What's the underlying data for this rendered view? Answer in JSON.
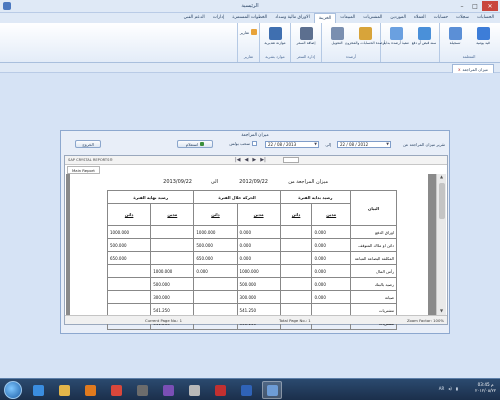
{
  "window": {
    "title": "الرئيسية",
    "controls": {
      "minimize": "–",
      "maximize": "□",
      "close": "✕"
    }
  },
  "ribbon_tabs": [
    {
      "label": "الحسابات",
      "active": false
    },
    {
      "label": "سجلات",
      "active": false
    },
    {
      "label": "حسابات",
      "active": false
    },
    {
      "label": "العملاء",
      "active": false
    },
    {
      "label": "الموردين",
      "active": false
    },
    {
      "label": "المشتريات",
      "active": false
    },
    {
      "label": "المبيعات",
      "active": false
    },
    {
      "label": "الخزينة",
      "active": true
    },
    {
      "label": "الاوراق مالية وسداد",
      "active": false
    },
    {
      "label": "الخطوات المستمرة",
      "active": false
    },
    {
      "label": "إدارات",
      "active": false
    },
    {
      "label": "الدعم الفني",
      "active": false
    }
  ],
  "ribbon_groups": [
    {
      "label": "المتعلمة",
      "buttons": [
        {
          "label": "قيد يومية",
          "icon": "journal-icon",
          "color": "#3d7dd8"
        },
        {
          "label": "تسجيلة",
          "icon": "doc-blue-icon",
          "color": "#5b8fd6"
        }
      ]
    },
    {
      "label": "",
      "buttons": [
        {
          "label": "سند قبض أو دفع",
          "icon": "receipt-icon",
          "color": "#4a90d9"
        },
        {
          "label": "تنفيذ أرصدة بداية",
          "icon": "balance-icon",
          "color": "#6aa0e0"
        }
      ]
    },
    {
      "label": "أرصدة",
      "buttons": [
        {
          "label": "أرصدة الحسابات والمخزون",
          "icon": "folder-stack-icon",
          "color": "#d8a43a"
        },
        {
          "label": "التحويل",
          "icon": "transfer-icon",
          "color": "#7a8fb0"
        }
      ]
    },
    {
      "label": "إدارة السعر",
      "buttons": [
        {
          "label": "إضافة السعر",
          "icon": "price-icon",
          "color": "#5c6f8f"
        }
      ]
    },
    {
      "label": "موارد بشرية",
      "buttons": [
        {
          "label": "موازنة تقديرية",
          "icon": "budget-icon",
          "color": "#3f6fb0"
        }
      ]
    },
    {
      "label": "تقارير",
      "small_buttons": [
        {
          "label": "تقارير",
          "icon": "report-icon"
        }
      ]
    }
  ],
  "document_tab": {
    "label": "ميزان المراجعة",
    "close": "x"
  },
  "report_window": {
    "title": "ميزان المراجعة",
    "from_label": "تقرير ميزان المراجعة عن",
    "from_date": "22 / 08 / 2012",
    "to_label": "إلى",
    "to_date": "22 / 08 / 2013",
    "zero_check_label": "سحب بولس",
    "show_button": "استعلام",
    "print_button": "الخروج"
  },
  "viewer": {
    "brand": "SAP CRYSTAL REPORTS®",
    "tab_label": "Main Report",
    "toolbar_icons": [
      "|◀",
      "◀",
      "▶",
      "▶|"
    ],
    "status": {
      "current_page": "Current Page No.: 1",
      "total_page": "Total Page No.: 1",
      "zoom": "Zoom Factor: 100%"
    }
  },
  "report": {
    "heading_title": "ميزان المراجعة من",
    "heading_from": "2012/09/22",
    "heading_to_label": "الى",
    "heading_to": "2013/09/22",
    "col_statement": "البيان",
    "col_groups": [
      "رصيد بداية الفترة",
      "الحركة خلال الفترة",
      "رصيد نهاية الفترة"
    ],
    "col_debit": "مدين",
    "col_credit": "دائن",
    "rows": [
      {
        "account": "اوراق الدفع",
        "values": [
          "0.000",
          "",
          "0.000",
          "1000.000",
          "",
          "1000.000"
        ]
      },
      {
        "account": "دائن او ملاك المتوقف",
        "values": [
          "0.000",
          "",
          "0.000",
          "500.000",
          "",
          "500.000"
        ]
      },
      {
        "account": "المكلفة البضاعة المباعة",
        "values": [
          "0.000",
          "",
          "0.000",
          "650.000",
          "",
          "650.000"
        ]
      },
      {
        "account": "رأس المال",
        "values": [
          "0.000",
          "",
          "1000.000",
          "0.000",
          "1000.000",
          ""
        ]
      },
      {
        "account": "رصيد بالبنك",
        "values": [
          "0.000",
          "",
          "500.000",
          "",
          "500.000",
          ""
        ]
      },
      {
        "account": "صيانة",
        "values": [
          "0.000",
          "",
          "300.000",
          "",
          "300.000",
          ""
        ]
      },
      {
        "account": "مشتريات",
        "values": [
          "",
          "",
          "541.250",
          "",
          "541.250",
          ""
        ]
      },
      {
        "account": "مشتريات",
        "values": [
          "",
          "",
          "541.250",
          "",
          "541.250",
          ""
        ]
      }
    ]
  },
  "taskbar": {
    "clock_time": "03:45 م",
    "clock_date": "٢٠١٢/٠٨/٢٢",
    "lang": "AR",
    "apps": [
      {
        "icon": "ie-icon",
        "color": "#3a8de0"
      },
      {
        "icon": "folder-icon",
        "color": "#e3b54a"
      },
      {
        "icon": "media-player-icon",
        "color": "#e07a1e"
      },
      {
        "icon": "chrome-icon",
        "color": "#d9473b"
      },
      {
        "icon": "paint-icon",
        "color": "#6c6c6c"
      },
      {
        "icon": "visual-studio-icon",
        "color": "#7a4fb5"
      },
      {
        "icon": "sql-icon",
        "color": "#b9b9b9"
      },
      {
        "icon": "app-icon",
        "color": "#c23030"
      },
      {
        "icon": "word-icon",
        "color": "#2f63b8"
      },
      {
        "icon": "app-window-icon",
        "color": "#6d9cd6"
      }
    ]
  }
}
